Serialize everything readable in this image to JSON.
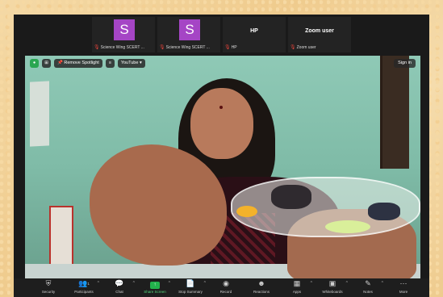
{
  "gallery": [
    {
      "initial": "S",
      "name": "Science Wing SCERT ...",
      "muted": true
    },
    {
      "initial": "S",
      "name": "Science Wing SCERT ...",
      "muted": true
    },
    {
      "display": "HP",
      "name": "HP",
      "muted": true
    },
    {
      "display": "Zoom user",
      "name": "Zoom user",
      "muted": true
    }
  ],
  "top_controls": {
    "remove_spotlight": "Remove Spotlight",
    "youtube": "YouTube",
    "sign_in": "Sign in"
  },
  "toolbar": [
    {
      "label": "Security",
      "icon": "shield-icon",
      "caret": false
    },
    {
      "label": "Participants",
      "icon": "participants-icon",
      "count": "1",
      "caret": true
    },
    {
      "label": "Chat",
      "icon": "chat-icon",
      "caret": true
    },
    {
      "label": "Share Screen",
      "icon": "share-screen-icon",
      "caret": true
    },
    {
      "label": "Stop Summary",
      "icon": "summary-icon",
      "caret": true
    },
    {
      "label": "Record",
      "icon": "record-icon",
      "caret": false
    },
    {
      "label": "Reactions",
      "icon": "reactions-icon",
      "caret": false
    },
    {
      "label": "Apps",
      "icon": "apps-icon",
      "caret": true
    },
    {
      "label": "Whiteboards",
      "icon": "whiteboard-icon",
      "caret": true
    },
    {
      "label": "Notes",
      "icon": "notes-icon",
      "caret": true
    },
    {
      "label": "More",
      "icon": "more-icon",
      "caret": false
    }
  ],
  "colors": {
    "avatar": "#a545c5",
    "share_green": "#22b14c",
    "mute_red": "#e0433a"
  }
}
